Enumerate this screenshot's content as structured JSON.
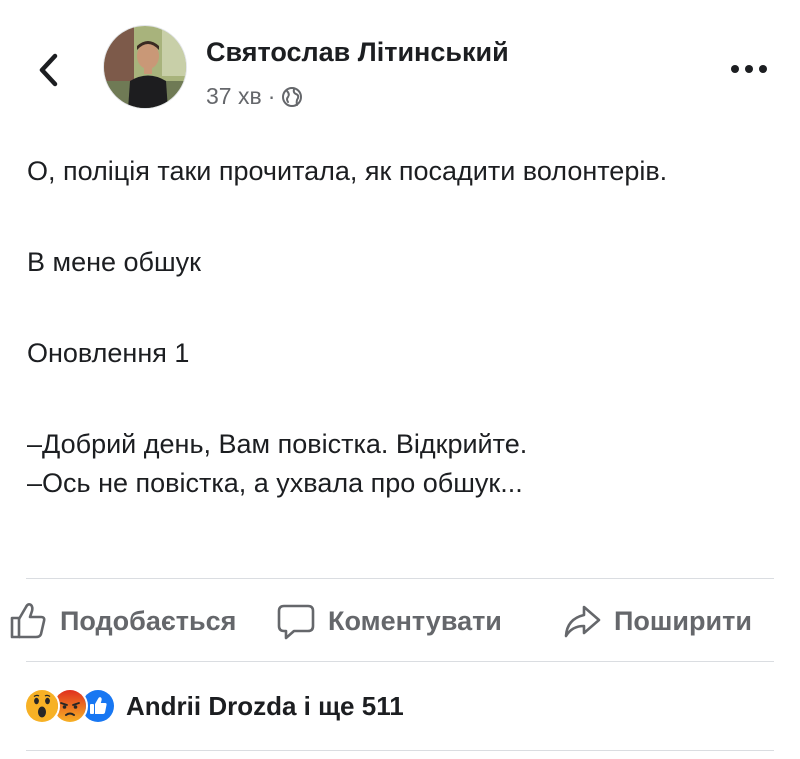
{
  "post": {
    "author": "Святослав Літинський",
    "time": "37 хв",
    "separator": "·",
    "paragraphs": [
      "О, поліція таки прочитала, як посадити волонтерів.",
      "В мене обшук",
      "Оновлення 1"
    ],
    "dialogue": [
      "–Добрий день, Вам повістка. Відкрийте.",
      "–Ось не повістка, а ухвала про обшук..."
    ]
  },
  "actions": {
    "like_label": "Подобається",
    "comment_label": "Коментувати",
    "share_label": "Поширити"
  },
  "reactions": {
    "icons": [
      "wow-icon",
      "angry-icon",
      "like-icon"
    ],
    "summary": "Andrii Drozda і ще 511"
  },
  "colors": {
    "text": "#1c1e21",
    "secondary": "#65676b",
    "like_blue": "#1877f2",
    "wow_yellow": "#f7b125",
    "angry_orange": "#e9710f"
  }
}
